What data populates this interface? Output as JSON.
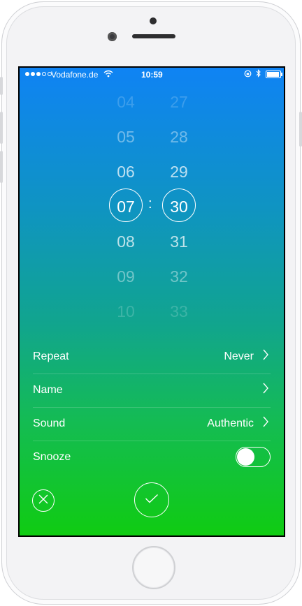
{
  "status_bar": {
    "signal_dots": 5,
    "signal_filled": 3,
    "carrier": "Vodafone.de",
    "time": "10:59",
    "wifi_icon": "wifi-icon",
    "rotation_lock_icon": "rotation-lock-icon",
    "bluetooth_icon": "bluetooth-icon",
    "battery_level": 0.95
  },
  "picker": {
    "hours": [
      "04",
      "05",
      "06",
      "07",
      "08",
      "09",
      "10"
    ],
    "minutes": [
      "27",
      "28",
      "29",
      "30",
      "31",
      "32",
      "33"
    ],
    "selected_hour": "07",
    "selected_minute": "30",
    "separator": ":"
  },
  "settings": {
    "repeat": {
      "label": "Repeat",
      "value": "Never"
    },
    "name": {
      "label": "Name",
      "value": ""
    },
    "sound": {
      "label": "Sound",
      "value": "Authentic"
    },
    "snooze": {
      "label": "Snooze",
      "enabled": false
    }
  },
  "actions": {
    "cancel_icon": "close-icon",
    "confirm_icon": "checkmark-icon"
  },
  "colors": {
    "gradient_top": "#0f83f4",
    "gradient_bottom": "#10cc12"
  }
}
